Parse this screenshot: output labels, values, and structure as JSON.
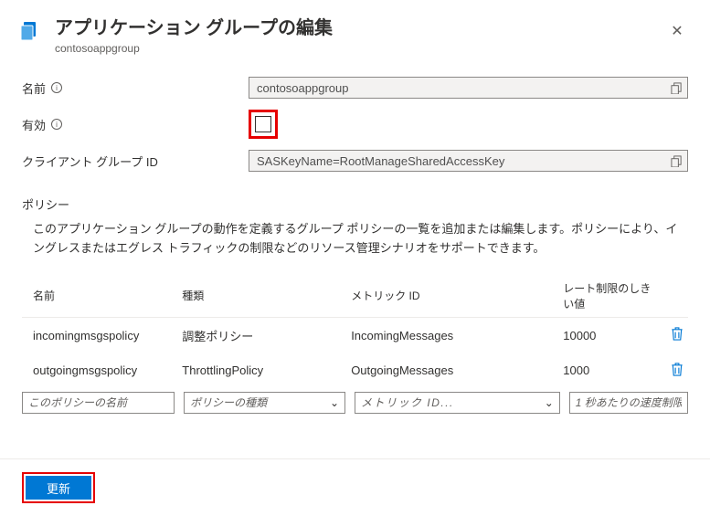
{
  "header": {
    "title": "アプリケーション グループの編集",
    "subtitle": "contosoappgroup"
  },
  "fields": {
    "name_label": "名前",
    "name_value": "contosoappgroup",
    "enabled_label": "有効",
    "client_group_label": "クライアント グループ ID",
    "client_group_value": "SASKeyName=RootManageSharedAccessKey"
  },
  "policy": {
    "section_title": "ポリシー",
    "description": "このアプリケーション グループの動作を定義するグループ ポリシーの一覧を追加または編集します。ポリシーにより、イングレスまたはエグレス トラフィックの制限などのリソース管理シナリオをサポートできます。",
    "columns": {
      "name": "名前",
      "type": "種類",
      "metric": "メトリック ID",
      "rate": "レート制限のしきい値"
    },
    "rows": [
      {
        "name": "incomingmsgspolicy",
        "type": "調整ポリシー",
        "metric": "IncomingMessages",
        "rate": "10000"
      },
      {
        "name": "outgoingmsgspolicy",
        "type": "ThrottlingPolicy",
        "metric": "OutgoingMessages",
        "rate": "1000"
      }
    ],
    "new_row": {
      "name_ph": "このポリシーの名前",
      "type_ph": "ポリシーの種類",
      "metric_ph": "メトリック ID...",
      "rate_ph": "1 秒あたりの速度制限"
    }
  },
  "footer": {
    "update": "更新"
  }
}
